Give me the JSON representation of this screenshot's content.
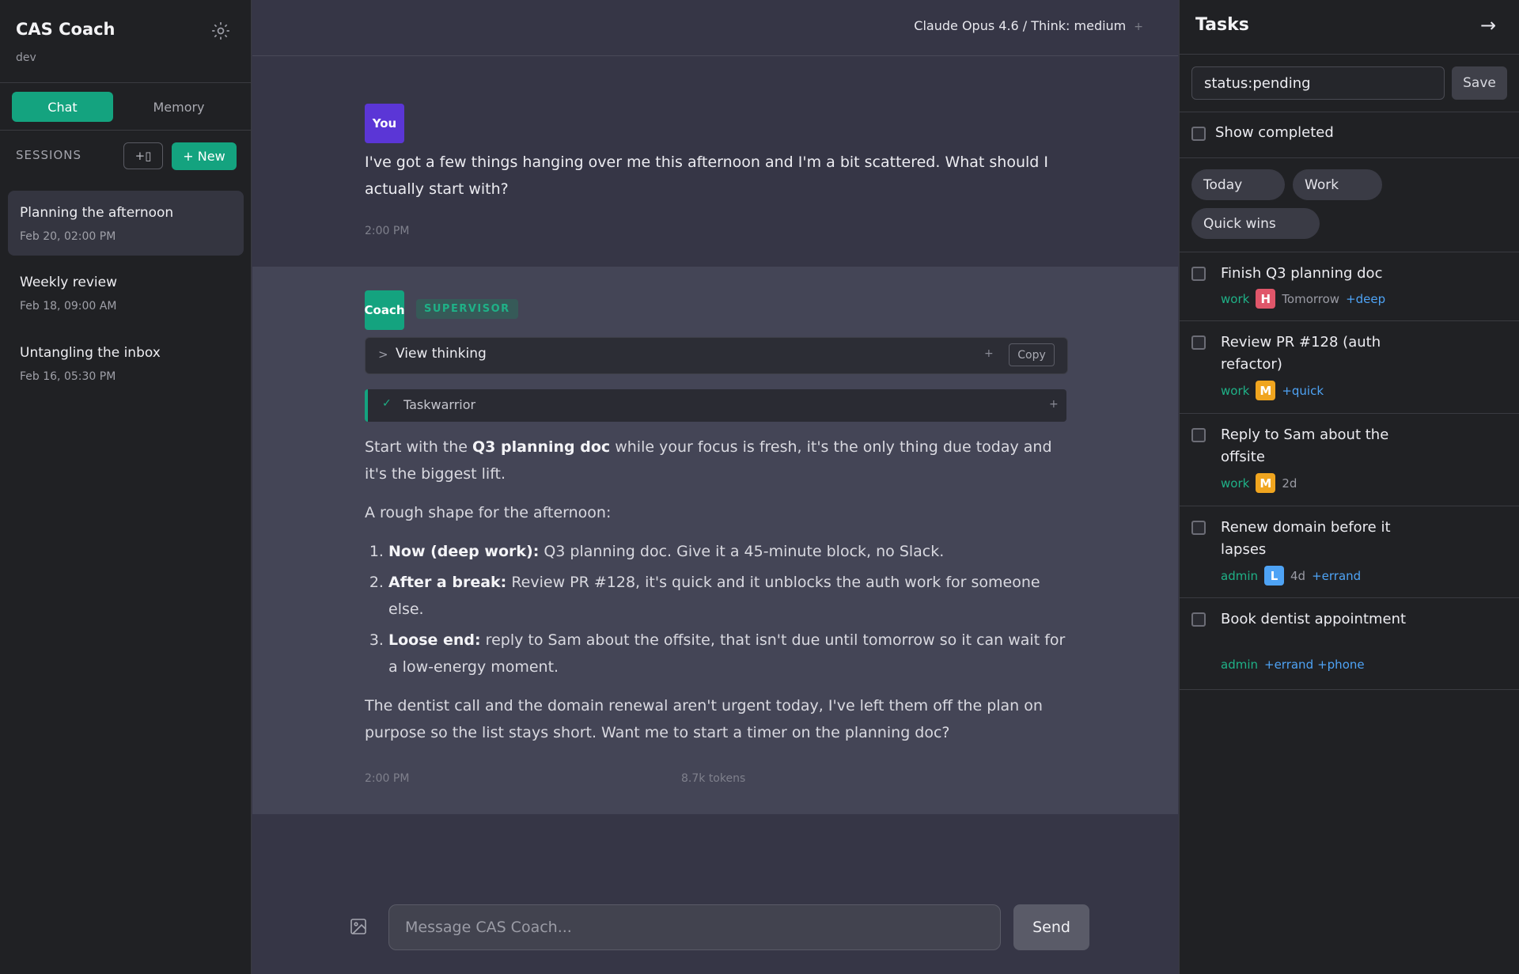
{
  "app": {
    "title": "CAS Coach",
    "env": "dev"
  },
  "sidebar": {
    "tabs": {
      "chat": "Chat",
      "memory": "Memory"
    },
    "sessions_label": "SESSIONS",
    "collapse_label": "+▯",
    "new_label": "+ New",
    "sessions": [
      {
        "title": "Planning the afternoon",
        "date": "Feb 20, 02:00 PM",
        "active": true
      },
      {
        "title": "Weekly review",
        "date": "Feb 18, 09:00 AM",
        "active": false
      },
      {
        "title": "Untangling the inbox",
        "date": "Feb 16, 05:30 PM",
        "active": false
      }
    ]
  },
  "topbar": {
    "model": "Claude Opus 4.6 / Think: medium",
    "plus": "+"
  },
  "messages": {
    "user": {
      "avatar": "You",
      "text": "I've got a few things hanging over me this afternoon and I'm a bit scattered. What should I actually start with?",
      "time": "2:00 PM"
    },
    "coach": {
      "avatar": "Coach",
      "badge": "SUPERVISOR",
      "thinking_label": "View thinking",
      "thinking_chevron": ">",
      "copy_label": "Copy",
      "tool_check": "✓",
      "tool_label": "Taskwarrior",
      "para1": {
        "a": "Start with the ",
        "b": "Q3 planning doc",
        "c": " while your focus is fresh, it's the only thing due today and it's the biggest lift."
      },
      "para2": "A rough shape for the afternoon:",
      "list": [
        {
          "bold": "Now (deep work):",
          "text": " Q3 planning doc. Give it a 45-minute block, no Slack."
        },
        {
          "bold": "After a break:",
          "text": " Review PR #128, it's quick and it unblocks the auth work for someone else."
        },
        {
          "bold": "Loose end:",
          "text": " reply to Sam about the offsite, that isn't due until tomorrow so it can wait for a low-energy moment."
        }
      ],
      "para3": "The dentist call and the domain renewal aren't urgent today, I've left them off the plan on purpose so the list stays short. Want me to start a timer on the planning doc?",
      "time": "2:00 PM",
      "tokens": "8.7k tokens"
    }
  },
  "composer": {
    "placeholder": "Message CAS Coach...",
    "send_label": "Send"
  },
  "tasks": {
    "title": "Tasks",
    "arrow": "→",
    "filter_value": "status:pending",
    "save_label": "Save",
    "show_completed": "Show completed",
    "chips": [
      "Today",
      "Work",
      "Quick wins"
    ],
    "items": [
      {
        "name": "Finish Q3 planning doc",
        "project": "work",
        "priority": "H",
        "due": "Tomorrow",
        "tags": [
          "+deep"
        ]
      },
      {
        "name": "Review PR #128 (auth refactor)",
        "project": "work",
        "priority": "M",
        "due": "",
        "tags": [
          "+quick"
        ]
      },
      {
        "name": "Reply to Sam about the offsite",
        "project": "work",
        "priority": "M",
        "due": "2d",
        "tags": []
      },
      {
        "name": "Renew domain before it lapses",
        "project": "admin",
        "priority": "L",
        "due": "4d",
        "tags": [
          "+errand"
        ]
      },
      {
        "name": "Book dentist appointment",
        "project": "admin",
        "priority": "",
        "due": "",
        "tags": [
          "+errand",
          "+phone"
        ]
      }
    ]
  },
  "colors": {
    "accent": "#14a37f",
    "you_avatar": "#5b36d6",
    "priority_H": "#e0566a",
    "priority_M": "#f0a51f",
    "priority_L": "#4ea3f5",
    "tag": "#4ea3f5"
  },
  "icons": {
    "settings": "gear-icon",
    "image_attach": "image-icon",
    "collapse": "collapse-icon"
  }
}
